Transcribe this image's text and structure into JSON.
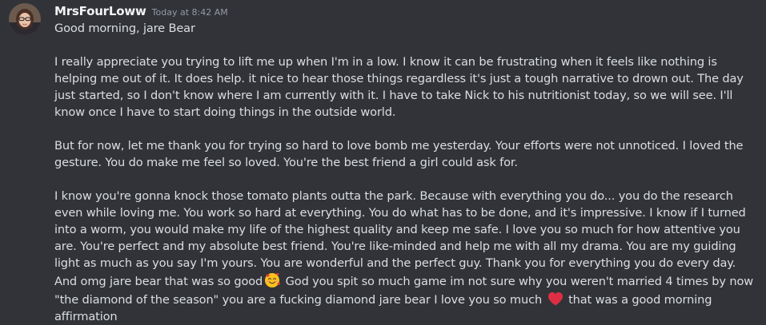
{
  "message": {
    "author": "MrsFourLoww",
    "timestamp": "Today at 8:42 AM",
    "greeting": "Good morning, jare Bear",
    "paragraph_1": "I really appreciate you trying to lift me up when I'm in a low. I know it can be frustrating when it feels like nothing is helping me out of it. It does help. it nice to hear those things regardless it's just a tough narrative to drown out. The day just started, so I don't know where I am currently with it. I have to take Nick to his nutritionist today, so we will see. I'll know once I have to start doing things in the outside world.",
    "paragraph_2": "But for now, let me thank you for trying so hard to love bomb me yesterday. Your efforts were not unnoticed. I loved the gesture. You do make me feel so loved. You're the best friend a girl could ask for.",
    "paragraph_3_part_1": "I know you're gonna knock those tomato plants outta the park. Because with everything you do... you do the research even while loving me. You work so hard at everything. You do what has to be done, and it's impressive. I know if I turned into a worm, you would make my life of the highest quality and keep me safe. I love you so much for how attentive you are. You're perfect and my absolute best friend. You're like-minded and help me with all my drama. You are my guiding light as much as you say I'm yours. You are wonderful and the perfect guy. Thank you for everything you do every day. And omg jare bear that was so good",
    "paragraph_3_part_2": " God you spit so much game im not sure why you weren't married 4 times by now \"the diamond of the season\" you are a fucking diamond jare bear I love you so much ",
    "paragraph_3_part_3": " that was a good morning affirmation",
    "emoji_1": "smiling-face-with-hearts-icon",
    "emoji_2": "red-heart-icon"
  },
  "colors": {
    "background": "#313338",
    "username": "#f2f3f5",
    "timestamp": "#949ba4",
    "text": "#dbdee1"
  }
}
